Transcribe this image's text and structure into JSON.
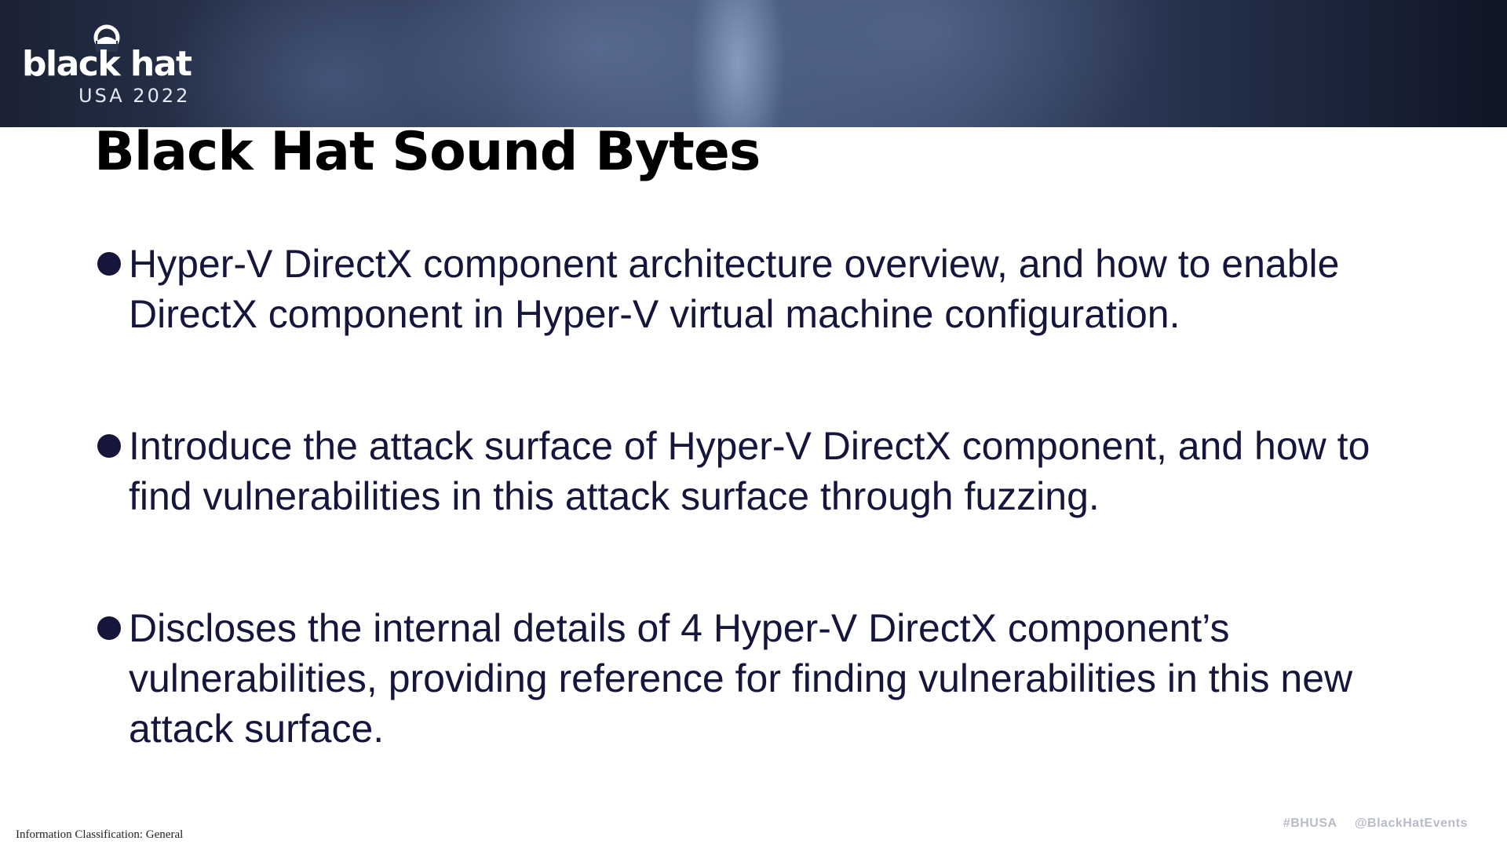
{
  "header": {
    "logo": {
      "wordmark": "black hat",
      "event": "USA 2022"
    }
  },
  "slide": {
    "title": "Black Hat Sound Bytes",
    "bullets": [
      "Hyper-V DirectX component architecture overview, and how to enable DirectX component in Hyper-V virtual machine configuration.",
      "Introduce the attack surface of Hyper-V DirectX component, and how to find vulnerabilities in this attack surface through fuzzing.",
      "Discloses the internal details of 4 Hyper-V DirectX component’s vulnerabilities, providing reference for finding vulnerabilities in this new attack surface."
    ]
  },
  "footer": {
    "classification": "Information Classification: General",
    "hashtag": "#BHUSA",
    "handle": "@BlackHatEvents"
  },
  "colors": {
    "title": "#000000",
    "body_text": "#16163c",
    "footer_tags": "#b7bcc6",
    "banner_dark": "#1a2233",
    "banner_light": "#4a5b80"
  }
}
